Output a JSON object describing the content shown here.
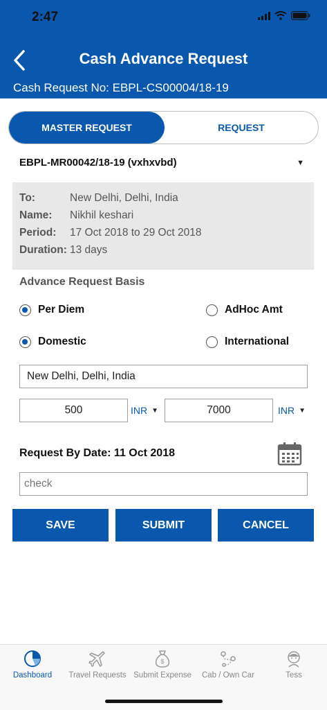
{
  "status_bar": {
    "time": "2:47"
  },
  "header": {
    "title": "Cash Advance Request",
    "request_no": "Cash Request No: EBPL-CS00004/18-19"
  },
  "segments": {
    "active": "MASTER REQUEST",
    "inactive": "REQUEST"
  },
  "master_request_select": "EBPL-MR00042/18-19 (vxhxvbd)",
  "info": {
    "rows": [
      {
        "label": "To:",
        "value": "New Delhi, Delhi, India"
      },
      {
        "label": "Name:",
        "value": "Nikhil keshari"
      },
      {
        "label": "Period:",
        "value": "17 Oct 2018 to 29 Oct 2018"
      },
      {
        "label": "Duration:",
        "value": "13 days"
      }
    ]
  },
  "basis": {
    "title": "Advance Request Basis",
    "options": {
      "per_diem": {
        "label": "Per Diem",
        "selected": true
      },
      "adhoc": {
        "label": "AdHoc Amt",
        "selected": false
      },
      "domestic": {
        "label": "Domestic",
        "selected": true
      },
      "international": {
        "label": "International",
        "selected": false
      }
    }
  },
  "location_field": "New Delhi, Delhi, India",
  "amounts": [
    {
      "value": "500",
      "currency": "INR"
    },
    {
      "value": "7000",
      "currency": "INR"
    }
  ],
  "request_by_date": "Request By Date: 11 Oct 2018",
  "remarks_field": "check",
  "buttons": {
    "save": "SAVE",
    "submit": "SUBMIT",
    "cancel": "CANCEL"
  },
  "tabbar": {
    "items": [
      {
        "label": "Dashboard",
        "icon": "dashboard-icon"
      },
      {
        "label": "Travel Requests",
        "icon": "airplane-icon"
      },
      {
        "label": "Submit Expense",
        "icon": "money-bag-icon"
      },
      {
        "label": "Cab / Own Car",
        "icon": "route-icon"
      },
      {
        "label": "Tess",
        "icon": "assistant-icon"
      }
    ]
  },
  "colors": {
    "primary": "#0a58ad",
    "info_bg": "#e8e8e8"
  }
}
